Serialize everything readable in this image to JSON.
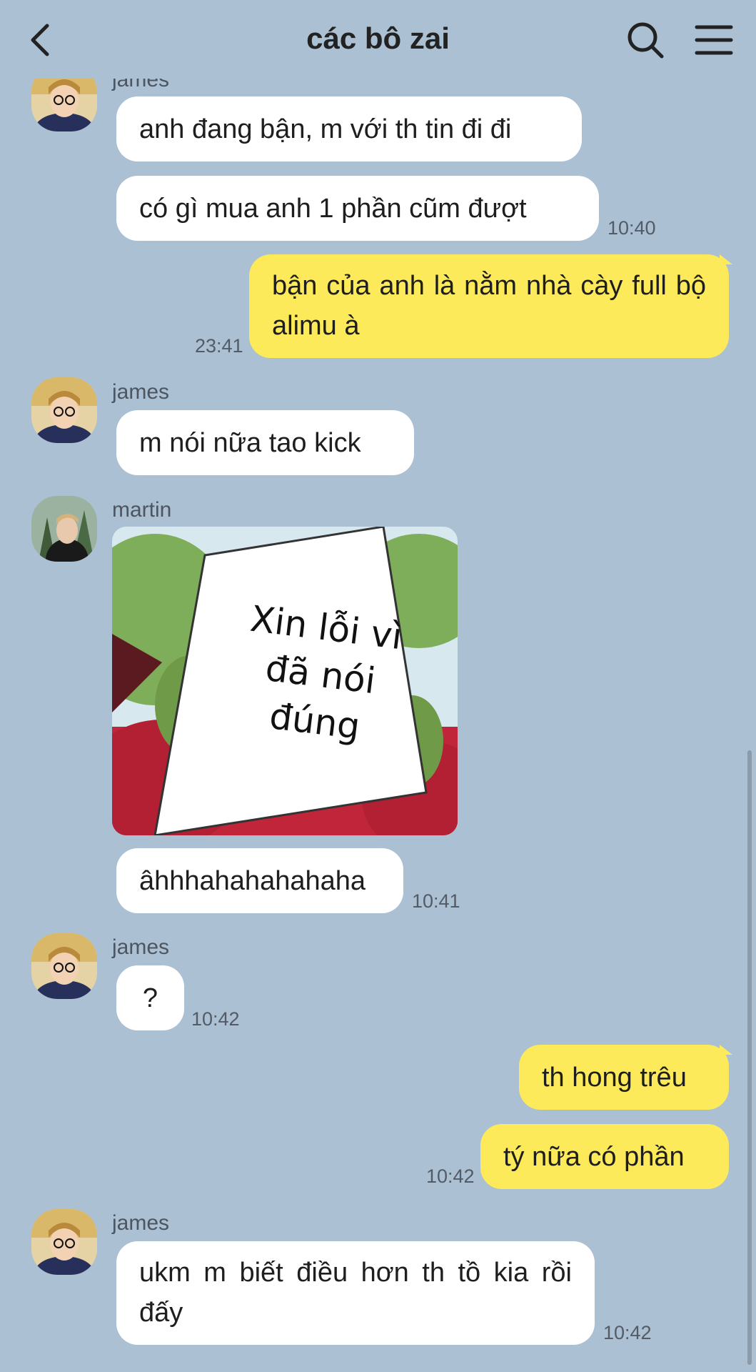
{
  "header": {
    "title": "các bô zai",
    "back_icon": "chevron-left-icon",
    "search_icon": "search-icon",
    "menu_icon": "menu-icon"
  },
  "colors": {
    "background": "#abc0d3",
    "incoming_bubble": "#ffffff",
    "outgoing_bubble": "#fcea5a"
  },
  "messages": [
    {
      "sender": "james",
      "text": "anh đang bận, m với th tin đi đi"
    },
    {
      "text": "có gì mua anh 1 phần cũm đượt",
      "time": "10:40"
    },
    {
      "text": "bận của anh là nằm nhà cày full bộ alimu à",
      "time": "23:41"
    },
    {
      "sender": "james",
      "text": "m nói nữa tao kick"
    },
    {
      "sender": "martin",
      "sticker_text": "Xin lỗi vì đã nói đúng"
    },
    {
      "text": "âhhhahahahahaha",
      "time": "10:41"
    },
    {
      "sender": "james",
      "text": "?",
      "time": "10:42"
    },
    {
      "text": "th hong trêu"
    },
    {
      "text": "tý nữa có phần",
      "time": "10:42"
    },
    {
      "sender": "james",
      "text": "ukm m biết điều hơn th tồ kia rồi đấy",
      "time": "10:42"
    }
  ]
}
